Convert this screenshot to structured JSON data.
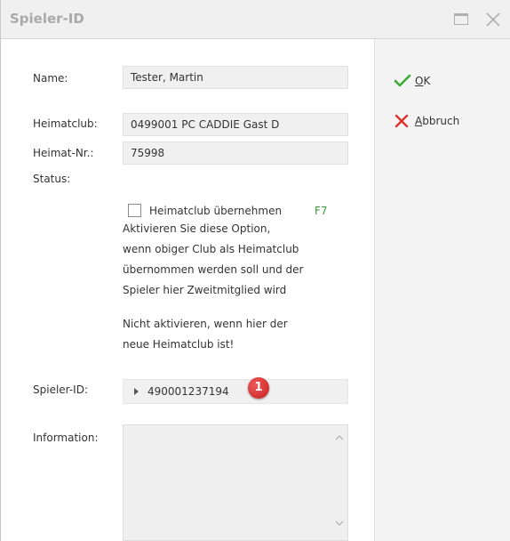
{
  "window": {
    "title": "Spieler-ID"
  },
  "form": {
    "name_label": "Name:",
    "name_value": "Tester, Martin",
    "heimatclub_label": "Heimatclub:",
    "heimatclub_value": "0499001 PC CADDIE Gast D",
    "heimatnr_label": "Heimat-Nr.:",
    "heimatnr_value": "75998",
    "status_label": "Status:",
    "checkbox_label": "Heimatclub übernehmen",
    "checkbox_checked": false,
    "checkbox_shortcut": "F7",
    "description_lines": [
      "Aktivieren Sie diese Option,",
      "wenn obiger Club als Heimatclub",
      "übernommen werden soll und der",
      "Spieler hier Zweitmitglied wird"
    ],
    "note_lines": [
      "Nicht aktivieren, wenn hier der",
      "neue Heimatclub ist!"
    ],
    "spielerid_label": "Spieler-ID:",
    "spielerid_value": "490001237194",
    "badge_number": "1",
    "information_label": "Information:",
    "information_value": ""
  },
  "actions": {
    "ok_label_underlined": "O",
    "ok_label_rest": "K",
    "cancel_label_underlined": "A",
    "cancel_label_rest": "bbruch"
  },
  "icons": {
    "ok": "check-icon",
    "cancel": "x-icon",
    "maximize": "maximize-icon",
    "close": "close-icon"
  },
  "colors": {
    "ok_icon": "#3aaa35",
    "cancel_icon": "#e03030",
    "shortcut_text": "#3a9a3a",
    "badge": "#d42a2a"
  }
}
